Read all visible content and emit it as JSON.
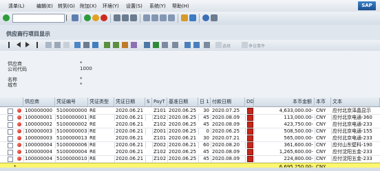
{
  "menu": [
    "清单(L)",
    "编辑(E)",
    "转到(G)",
    "附加(X)",
    "环境(Y)",
    "设置(S)",
    "系统(Y)",
    "帮助(H)"
  ],
  "brand": "SAP",
  "title": "供应商行项目显示",
  "app_toolbar": {
    "select_label": "选择",
    "dispute_label": "争议事件"
  },
  "header": {
    "vendor_label": "供应商",
    "vendor_value": "*",
    "company_label": "公司代码",
    "company_value": "1000",
    "name_label": "名称",
    "name_value": "*",
    "city_label": "城市",
    "city_value": "*"
  },
  "columns": [
    "供应商",
    "凭证编号",
    "凭证类型",
    "凭证日期",
    "S",
    "PayT",
    "基准日期",
    "日 1",
    "付款日期",
    "DD",
    "本币金额",
    "本币",
    "文本"
  ],
  "rows": [
    {
      "vendor": "100000000",
      "doc": "5100000000",
      "type": "RE",
      "docdate": "2020.06.21",
      "s": "",
      "payt": "Z101",
      "base": "2020.06.25",
      "days": "30",
      "paydate": "2020.07.25",
      "amount": "4,633,000.00-",
      "cur": "CNY",
      "text": "应付北京泽晶显示"
    },
    {
      "vendor": "100000001",
      "doc": "5100000001",
      "type": "RE",
      "docdate": "2020.06.21",
      "s": "",
      "payt": "Z102",
      "base": "2020.06.25",
      "days": "45",
      "paydate": "2020.08.09",
      "amount": "113,000.00-",
      "cur": "CNY",
      "text": "应付北京电通-360"
    },
    {
      "vendor": "100000002",
      "doc": "5100000002",
      "type": "RE",
      "docdate": "2020.06.21",
      "s": "",
      "payt": "Z102",
      "base": "2020.06.25",
      "days": "45",
      "paydate": "2020.08.09",
      "amount": "423,750.00-",
      "cur": "CNY",
      "text": "应付北京电通-233"
    },
    {
      "vendor": "100000003",
      "doc": "5100000003",
      "type": "RE",
      "docdate": "2020.06.21",
      "s": "",
      "payt": "Z001",
      "base": "2020.06.25",
      "days": "0",
      "paydate": "2020.06.25",
      "amount": "508,500.00-",
      "cur": "CNY",
      "text": "应付北京电通-155"
    },
    {
      "vendor": "100000003",
      "doc": "5100000013",
      "type": "RE",
      "docdate": "2020.06.21",
      "s": "",
      "payt": "Z101",
      "base": "2020.06.21",
      "days": "30",
      "paydate": "2020.07.21",
      "amount": "565,000.00-",
      "cur": "CNY",
      "text": "应付北京电通-233"
    },
    {
      "vendor": "100000004",
      "doc": "5100000006",
      "type": "RE",
      "docdate": "2020.06.21",
      "s": "",
      "payt": "Z002",
      "base": "2020.06.21",
      "days": "60",
      "paydate": "2020.08.20",
      "amount": "361,600.00-",
      "cur": "CNY",
      "text": "应付山东壁科-190"
    },
    {
      "vendor": "100000004",
      "doc": "5100000004",
      "type": "RE",
      "docdate": "2020.06.21",
      "s": "",
      "payt": "Z102",
      "base": "2020.06.25",
      "days": "45",
      "paydate": "2020.08.09",
      "amount": "1,265,600.00-",
      "cur": "CNY",
      "text": "应付沈阳五金-233"
    },
    {
      "vendor": "100000004",
      "doc": "5100000010",
      "type": "RE",
      "docdate": "2020.06.21",
      "s": "",
      "payt": "Z102",
      "base": "2020.06.25",
      "days": "45",
      "paydate": "2020.08.09",
      "amount": "224,800.00-",
      "cur": "CNY",
      "text": "应付沈阳五金-233"
    }
  ],
  "total": {
    "marker": "*",
    "amount": "6,695,250.00-",
    "cur": "CNY"
  }
}
